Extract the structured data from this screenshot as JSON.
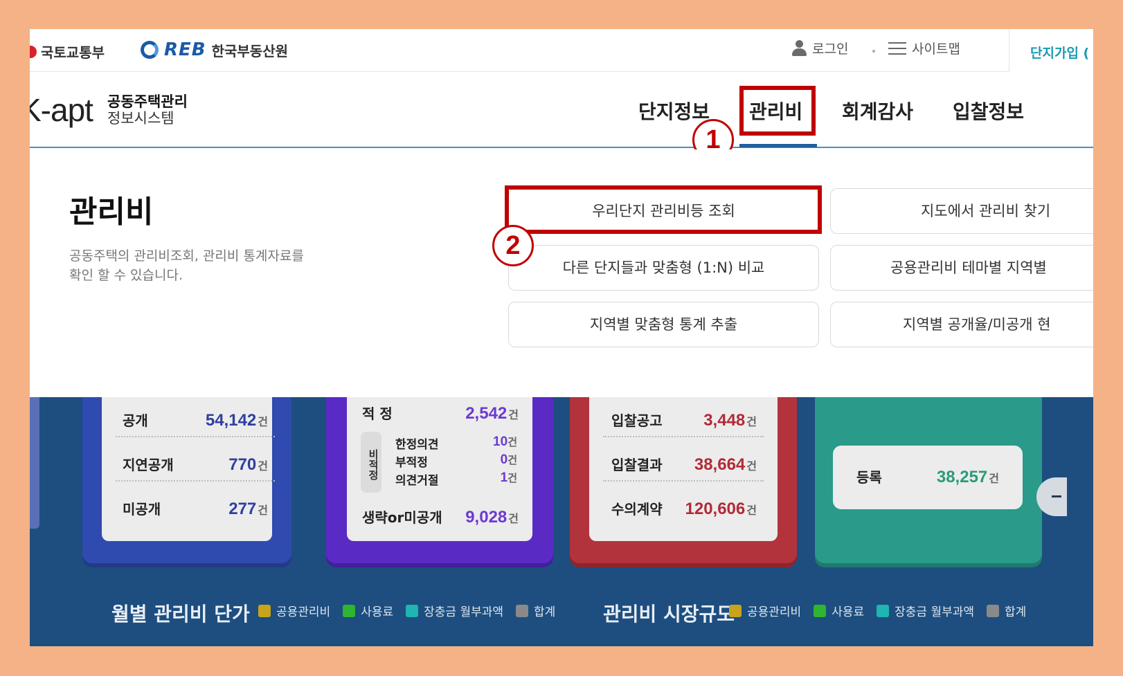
{
  "topbar": {
    "gov_name": "국토교통부",
    "reb_mark": "REB",
    "reb_name": "한국부동산원",
    "login": "로그인",
    "sitemap": "사이트맵",
    "join": "단지가입 ("
  },
  "header": {
    "logo": "K-apt",
    "logo_sub1": "공동주택관리",
    "logo_sub2": "정보시스템",
    "nav": [
      "단지정보",
      "관리비",
      "회계감사",
      "입찰정보"
    ],
    "active_nav": "관리비"
  },
  "annotations": {
    "step1": "1",
    "step2": "2",
    "highlight_color": "#c00000"
  },
  "panel": {
    "title": "관리비",
    "desc_line1": "공동주택의 관리비조회, 관리비 통계자료를",
    "desc_line2": "확인 할 수 있습니다.",
    "buttons": [
      "우리단지 관리비등 조회",
      "지도에서 관리비 찾기",
      "다른 단지들과 맞춤형 (1:N) 비교",
      "공용관리비 테마별 지역별 ",
      "지역별 맞춤형 통계 추출",
      "지역별 공개율/미공개 현"
    ]
  },
  "stats": {
    "card1": [
      {
        "label": "공개",
        "value": "54,142",
        "unit": "건"
      },
      {
        "label": "지연공개",
        "value": "770",
        "unit": "건"
      },
      {
        "label": "미공개",
        "value": "277",
        "unit": "건"
      }
    ],
    "card2": {
      "top": {
        "label": "적 정",
        "value": "2,542",
        "unit": "건"
      },
      "badge": "비적정",
      "subs": [
        {
          "label": "한정의견",
          "value": "10",
          "unit": "건"
        },
        {
          "label": "부적정",
          "value": "0",
          "unit": "건"
        },
        {
          "label": "의견거절",
          "value": "1",
          "unit": "건"
        }
      ],
      "bottom": {
        "label": "생략or미공개",
        "value": "9,028",
        "unit": "건"
      }
    },
    "card3": [
      {
        "label": "입찰공고",
        "value": "3,448",
        "unit": "건"
      },
      {
        "label": "입찰결과",
        "value": "38,664",
        "unit": "건"
      },
      {
        "label": "수의계약",
        "value": "120,606",
        "unit": "건"
      }
    ],
    "card4": {
      "label": "등록",
      "value": "38,257",
      "unit": "건"
    }
  },
  "bottom": {
    "title1": "월별 관리비 단가",
    "title2": "관리비 시장규모",
    "legend": [
      {
        "label": "공용관리비",
        "color": "#c9a31a"
      },
      {
        "label": "사용료",
        "color": "#2fb52f"
      },
      {
        "label": "장충금 월부과액",
        "color": "#1fb5b0"
      },
      {
        "label": "합계",
        "color": "#8a8a8a"
      }
    ]
  }
}
